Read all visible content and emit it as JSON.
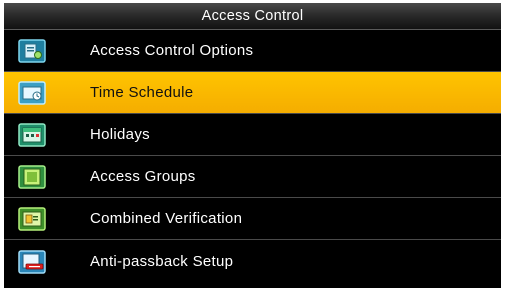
{
  "header": {
    "title": "Access Control"
  },
  "menu": {
    "selected_index": 1,
    "items": [
      {
        "label": "Access Control Options",
        "icon": "access-control-options-icon"
      },
      {
        "label": "Time Schedule",
        "icon": "time-schedule-icon"
      },
      {
        "label": "Holidays",
        "icon": "holidays-icon"
      },
      {
        "label": "Access Groups",
        "icon": "access-groups-icon"
      },
      {
        "label": "Combined Verification",
        "icon": "combined-verification-icon"
      },
      {
        "label": "Anti-passback Setup",
        "icon": "anti-passback-icon"
      }
    ]
  },
  "colors": {
    "selected_background": "#f7b500",
    "background": "#000000",
    "text": "#ffffff",
    "divider": "#4a4a4a"
  }
}
